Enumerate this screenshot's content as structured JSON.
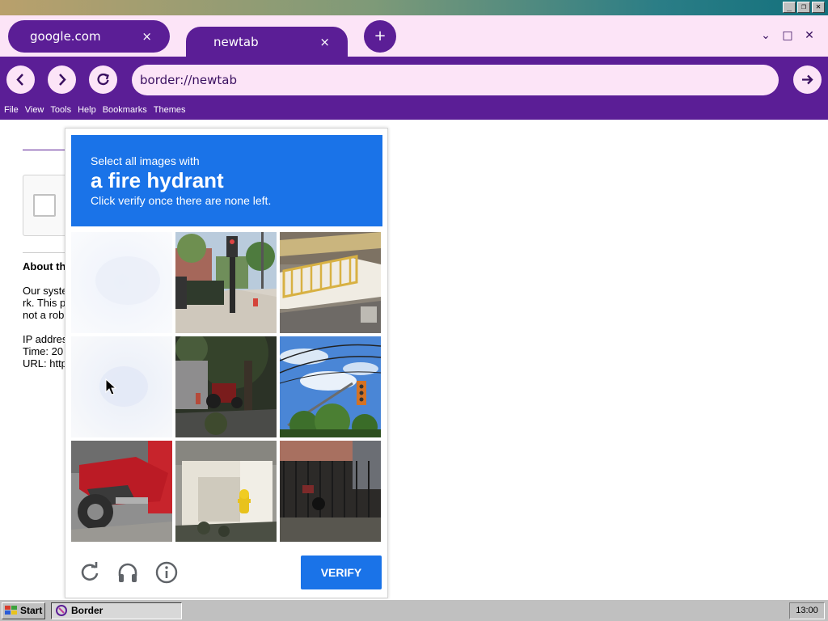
{
  "window": {
    "min_label": "_",
    "restore_label": "❐",
    "close_label": "✕"
  },
  "tabs": [
    {
      "title": "google.com",
      "close": "×",
      "active": false
    },
    {
      "title": "newtab",
      "close": "×",
      "active": true
    }
  ],
  "new_tab_label": "+",
  "browser_window": {
    "minimize": "⌄",
    "maximize": "□",
    "close": "✕"
  },
  "nav": {
    "back": "‹",
    "forward": "›",
    "reload": "↻",
    "go": "→"
  },
  "url": "border://newtab",
  "menu": [
    "File",
    "View",
    "Tools",
    "Help",
    "Bookmarks",
    "Themes"
  ],
  "page": {
    "about_heading": "About th",
    "para_lines": [
      "Our syste",
      "rk. This p",
      "not a rob"
    ],
    "meta_lines": [
      "IP addres",
      "Time: 20",
      "URL: http"
    ]
  },
  "captcha": {
    "line1": "Select all images with",
    "target": "a fire hydrant",
    "line3": "Click verify once there are none left.",
    "tiles": [
      {
        "name": "faded-blank",
        "selected": false
      },
      {
        "name": "street-sidewalk-hydrant",
        "selected": false
      },
      {
        "name": "balcony",
        "selected": false
      },
      {
        "name": "faded-blank",
        "selected": false
      },
      {
        "name": "tree-tractor",
        "selected": false
      },
      {
        "name": "traffic-light-sky",
        "selected": false
      },
      {
        "name": "motorcycle",
        "selected": false
      },
      {
        "name": "yellow-hydrant-wall",
        "selected": false
      },
      {
        "name": "dark-motorcycle-building",
        "selected": false
      }
    ],
    "verify_label": "VERIFY",
    "icons": [
      "reload-icon",
      "headphones-icon",
      "info-icon"
    ]
  },
  "taskbar": {
    "start_label": "Start",
    "task_label": "Border",
    "clock": "13:00"
  },
  "colors": {
    "brand_purple": "#5b1e96",
    "tab_pink": "#fce4f7",
    "captcha_blue": "#1a73e8"
  }
}
